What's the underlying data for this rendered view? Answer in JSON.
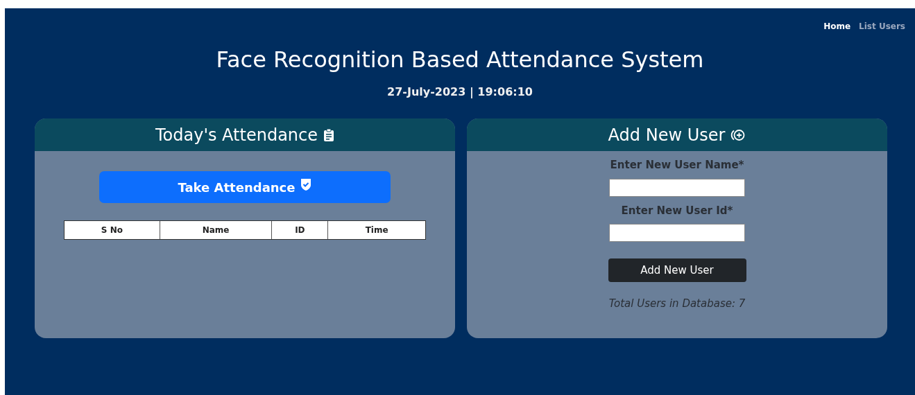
{
  "nav": [
    {
      "label": "Home",
      "selected": true
    },
    {
      "label": "List Users",
      "selected": false
    }
  ],
  "title": "Face Recognition Based Attendance System",
  "datetime": "27-July-2023 | 19:06:10",
  "attendance": {
    "title": "Today's Attendance",
    "button": "Take Attendance",
    "table": {
      "columns": [
        "S No",
        "Name",
        "ID",
        "Time"
      ]
    }
  },
  "add_user": {
    "title": "Add New User",
    "fields": [
      {
        "label": "Enter New User Name*"
      },
      {
        "label": "Enter New User Id*"
      }
    ],
    "button": "Add New User",
    "total": "Total Users in Database: 7"
  }
}
